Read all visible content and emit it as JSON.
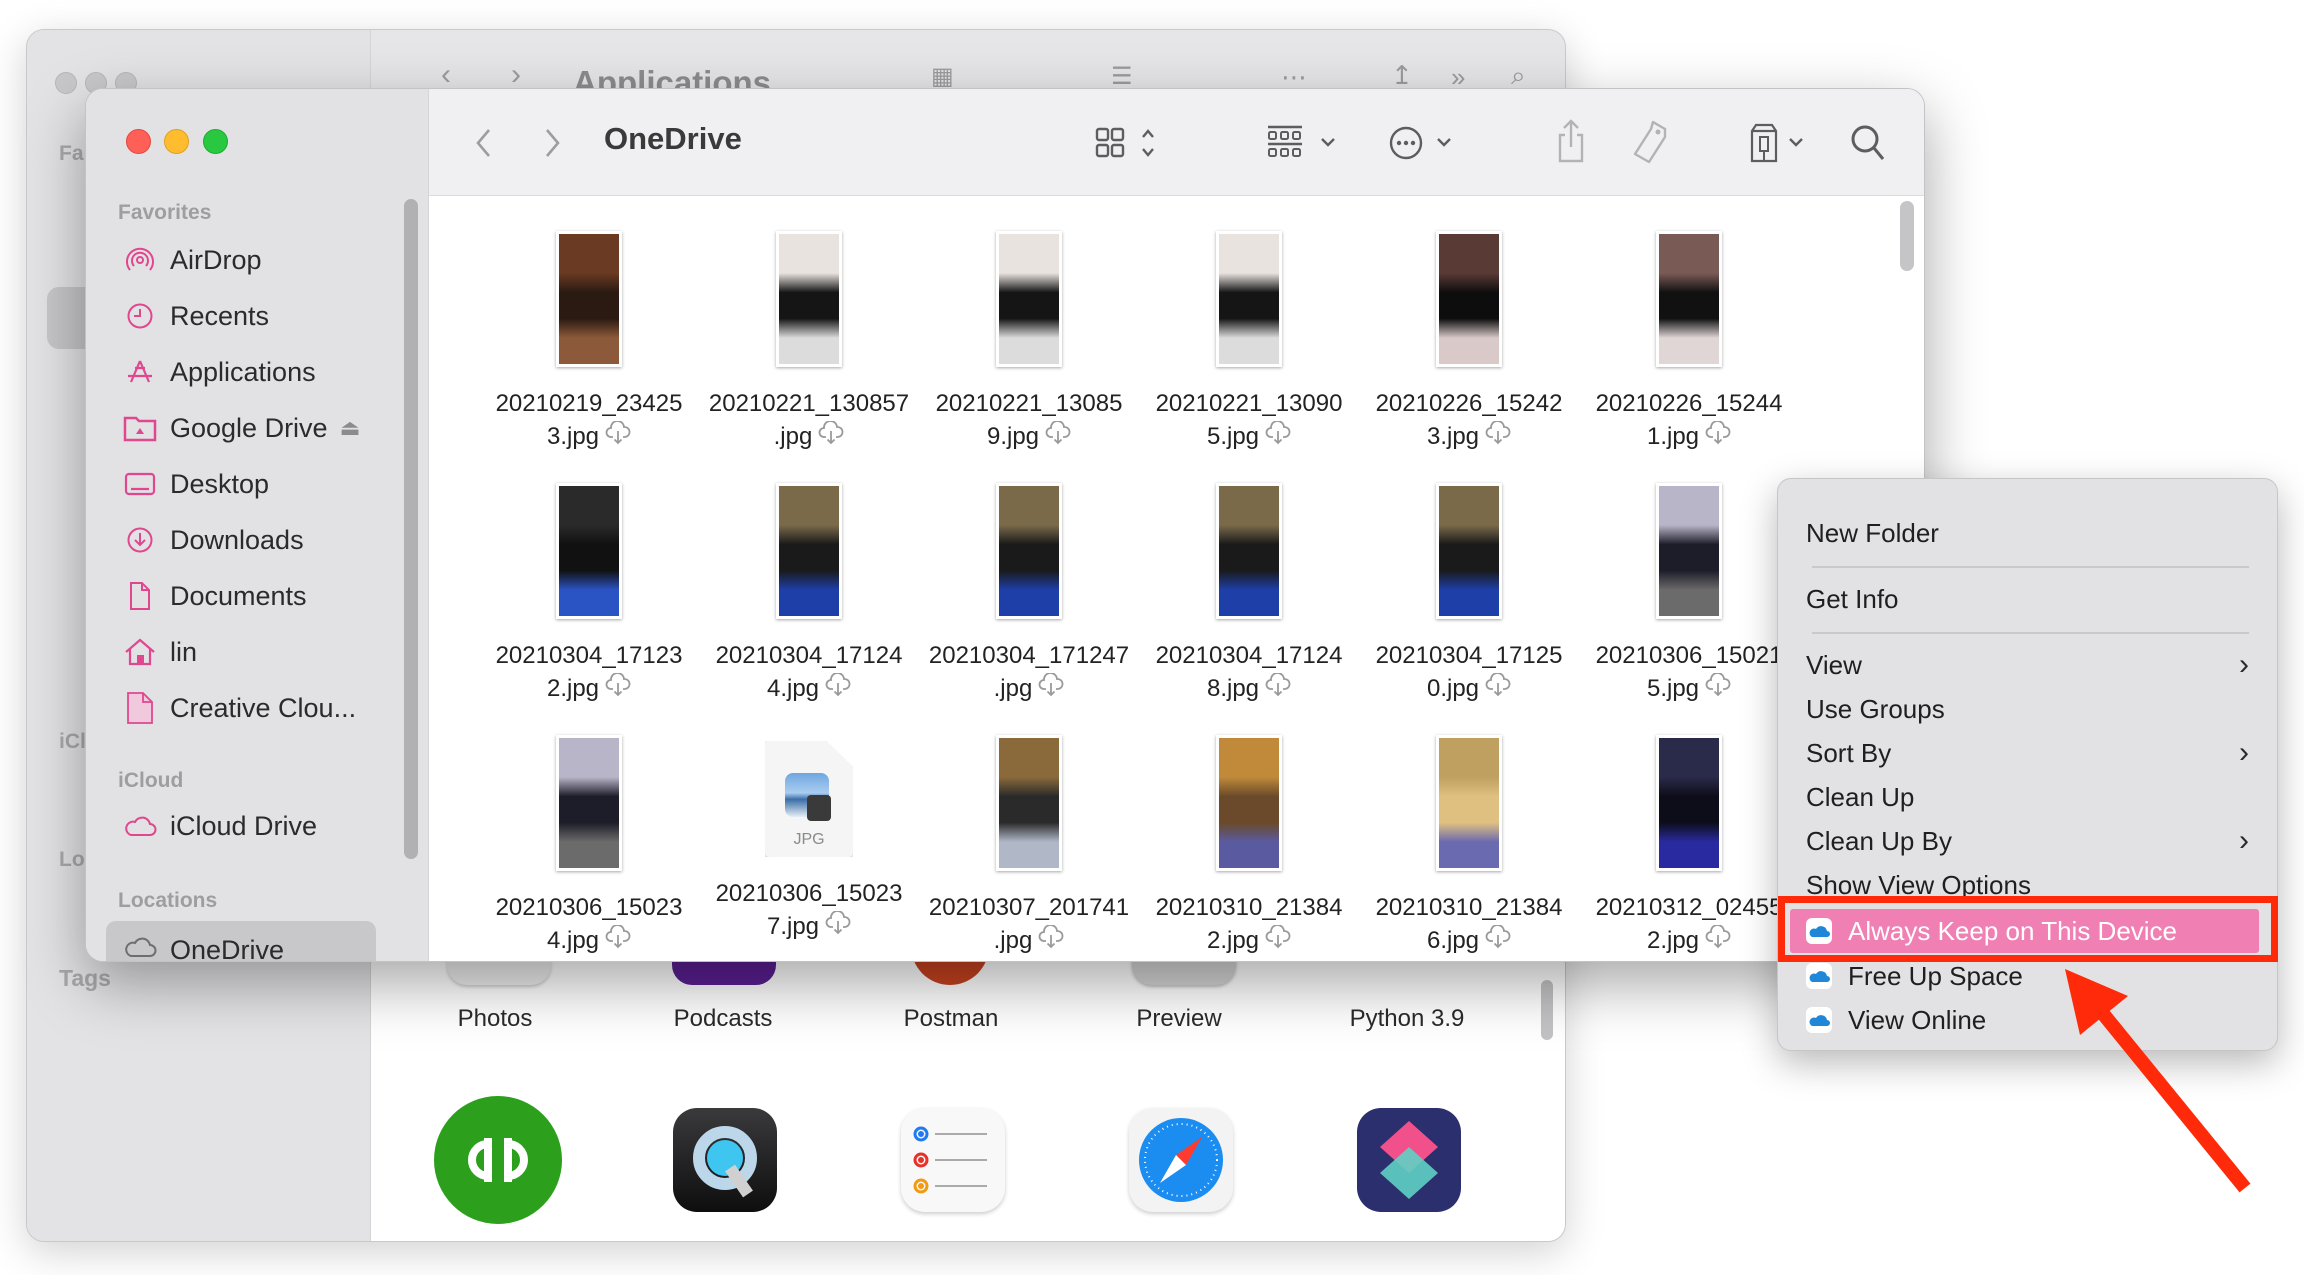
{
  "background_window": {
    "title": "Applications",
    "sidebar_fragments": [
      "Fa",
      "iCl",
      "Lo",
      "Tags"
    ],
    "apps_row_labels": [
      "Photos",
      "Podcasts",
      "Postman",
      "Preview",
      "Python 3.9"
    ],
    "apps_row_icons": [
      "quickbooks-icon",
      "quicktime-icon",
      "reminders-icon",
      "safari-icon",
      "shortcuts-icon"
    ]
  },
  "window": {
    "title": "OneDrive",
    "toolbar": {
      "back": "back-icon",
      "forward": "forward-icon",
      "view_mode": "icon-view-icon",
      "group": "group-icon",
      "action": "more-icon",
      "share": "share-icon",
      "tag": "tag-icon",
      "onedrive": "onedrive-status-icon",
      "search": "search-icon"
    }
  },
  "sidebar": {
    "sections": [
      {
        "header": "Favorites",
        "items": [
          {
            "label": "AirDrop",
            "icon": "airdrop-icon"
          },
          {
            "label": "Recents",
            "icon": "clock-icon"
          },
          {
            "label": "Applications",
            "icon": "applications-icon"
          },
          {
            "label": "Google Drive",
            "icon": "folder-icon",
            "eject": true
          },
          {
            "label": "Desktop",
            "icon": "desktop-icon"
          },
          {
            "label": "Downloads",
            "icon": "download-icon"
          },
          {
            "label": "Documents",
            "icon": "document-icon"
          },
          {
            "label": "lin",
            "icon": "home-icon"
          },
          {
            "label": "Creative Clou...",
            "icon": "file-icon"
          }
        ]
      },
      {
        "header": "iCloud",
        "items": [
          {
            "label": "iCloud Drive",
            "icon": "cloud-icon"
          }
        ]
      },
      {
        "header": "Locations",
        "items": [
          {
            "label": "OneDrive",
            "icon": "cloud-icon",
            "selected": true
          }
        ]
      }
    ]
  },
  "files": [
    {
      "line1": "20210219_23425",
      "line2": "3.jpg",
      "status": "cloud-download"
    },
    {
      "line1": "20210221_130857",
      "line2": ".jpg",
      "status": "cloud-download"
    },
    {
      "line1": "20210221_13085",
      "line2": "9.jpg",
      "status": "cloud-download"
    },
    {
      "line1": "20210221_13090",
      "line2": "5.jpg",
      "status": "cloud-download"
    },
    {
      "line1": "20210226_15242",
      "line2": "3.jpg",
      "status": "cloud-download"
    },
    {
      "line1": "20210226_15244",
      "line2": "1.jpg",
      "status": "cloud-download"
    },
    {
      "line1": "20210304_17123",
      "line2": "2.jpg",
      "status": "cloud-download"
    },
    {
      "line1": "20210304_17124",
      "line2": "4.jpg",
      "status": "cloud-download"
    },
    {
      "line1": "20210304_171247",
      "line2": ".jpg",
      "status": "cloud-download"
    },
    {
      "line1": "20210304_17124",
      "line2": "8.jpg",
      "status": "cloud-download"
    },
    {
      "line1": "20210304_17125",
      "line2": "0.jpg",
      "status": "cloud-download"
    },
    {
      "line1": "20210306_15021",
      "line2": "5.jpg",
      "status": "cloud-download"
    },
    {
      "line1": "20210306_15023",
      "line2": "4.jpg",
      "status": "cloud-download"
    },
    {
      "line1": "20210306_15023",
      "line2": "7.jpg",
      "status": "cloud-download",
      "generic_label": "JPG"
    },
    {
      "line1": "20210307_201741",
      "line2": ".jpg",
      "status": "cloud-download"
    },
    {
      "line1": "20210310_21384",
      "line2": "2.jpg",
      "status": "cloud-download"
    },
    {
      "line1": "20210310_21384",
      "line2": "6.jpg",
      "status": "cloud-download"
    },
    {
      "line1": "20210312_02455",
      "line2": "2.jpg",
      "status": "cloud-download"
    }
  ],
  "context_menu": {
    "groups": [
      [
        {
          "label": "New Folder"
        }
      ],
      [
        {
          "label": "Get Info"
        }
      ],
      [
        {
          "label": "View",
          "submenu": true
        },
        {
          "label": "Use Groups"
        },
        {
          "label": "Sort By",
          "submenu": true
        },
        {
          "label": "Clean Up"
        },
        {
          "label": "Clean Up By",
          "submenu": true
        },
        {
          "label": "Show View Options"
        }
      ]
    ],
    "onedrive_items": [
      {
        "label": "Always Keep on This Device",
        "highlighted": true
      },
      {
        "label": "Free Up Space"
      },
      {
        "label": "View Online"
      }
    ],
    "highlight_color": "#f07fb3",
    "annotation_color": "#ff2a0a"
  }
}
